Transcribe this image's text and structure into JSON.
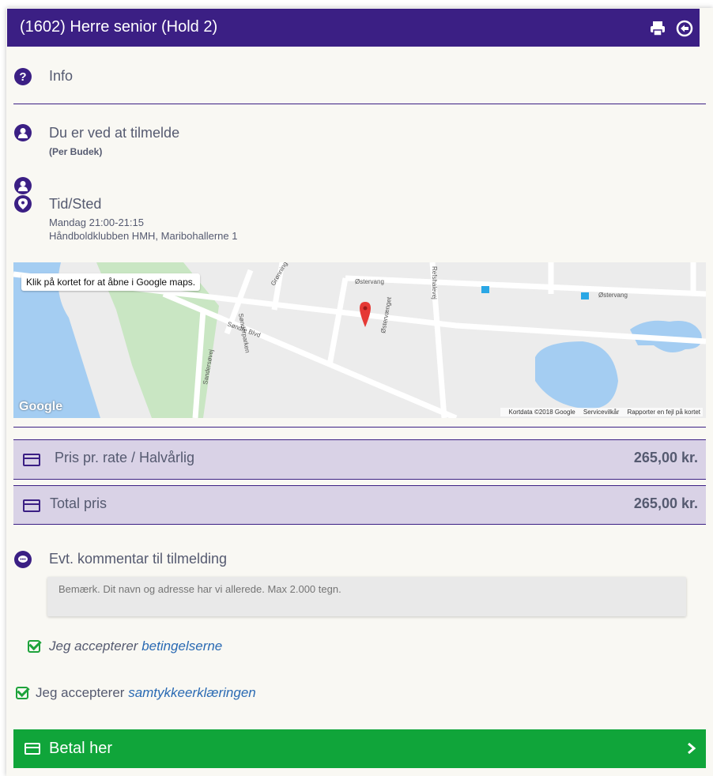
{
  "header": {
    "title": "(1602) Herre senior (Hold 2)",
    "icons": [
      "print-icon",
      "back-arrow-icon"
    ]
  },
  "info": {
    "label": "Info"
  },
  "register": {
    "label": "Du er ved at tilmelde",
    "person": "(Per Budek)"
  },
  "time_place": {
    "label": "Tid/Sted",
    "time": "Mandag 21:00-21:15",
    "place": "Håndboldklubben HMH, Maribohallerne 1"
  },
  "map": {
    "tip": "Klik på kortet for at åbne i Google maps.",
    "logo": "Google",
    "footer": [
      "Kortdata ©2018 Google",
      "Servicevilkår",
      "Rapporter en fejl på kortet"
    ],
    "street_labels": [
      "Østervang",
      "Østervang",
      "Refshalevej",
      "Østervænget",
      "Søndre Blvd",
      "Grønning",
      "Sandersøvej",
      "Sønderparken"
    ]
  },
  "prices": {
    "rate_label": "Pris pr. rate / Halvårlig",
    "rate_value": "265,00 kr.",
    "total_label": "Total pris",
    "total_value": "265,00 kr."
  },
  "comment": {
    "label": "Evt. kommentar til tilmelding",
    "placeholder": "Bemærk. Dit navn og adresse har vi allerede. Max 2.000 tegn."
  },
  "accept1": {
    "text": "Jeg accepterer",
    "link": "betingelserne"
  },
  "accept2": {
    "text": "Jeg accepterer",
    "link": "samtykkeerklæringen"
  },
  "pay_button": {
    "label": "Betal her"
  },
  "colors": {
    "accent": "#3b1f84",
    "pay": "#10a53a",
    "price_bg": "#d9d2e6",
    "link": "#2a6ab3"
  }
}
